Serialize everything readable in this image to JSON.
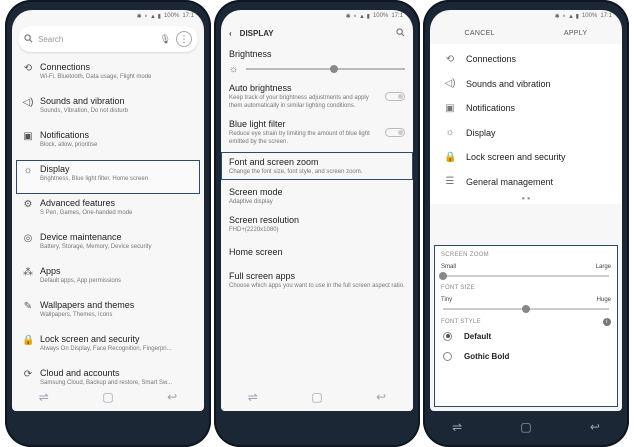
{
  "status": {
    "icons": "✱ ⚬ ▲ ▮",
    "battery": "100%",
    "time": "17:1"
  },
  "navbar": {
    "recent_icon": "recent-apps-icon",
    "home_icon": "home-icon",
    "back_icon": "back-icon"
  },
  "phone1": {
    "search_placeholder": "Search",
    "items": [
      {
        "icon": "connections-icon",
        "title": "Connections",
        "subtitle": "Wi-Fi, Bluetooth, Data usage, Flight mode"
      },
      {
        "icon": "sound-icon",
        "title": "Sounds and vibration",
        "subtitle": "Sounds, Vibration, Do not disturb"
      },
      {
        "icon": "notifications-icon",
        "title": "Notifications",
        "subtitle": "Block, allow, prioritise"
      },
      {
        "icon": "display-icon",
        "title": "Display",
        "subtitle": "Brightness, Blue light filter, Home screen"
      },
      {
        "icon": "advanced-features-icon",
        "title": "Advanced features",
        "subtitle": "S Pen, Games, One-handed mode"
      },
      {
        "icon": "device-maintenance-icon",
        "title": "Device maintenance",
        "subtitle": "Battery, Storage, Memory, Device security"
      },
      {
        "icon": "apps-icon",
        "title": "Apps",
        "subtitle": "Default apps, App permissions"
      },
      {
        "icon": "wallpaper-icon",
        "title": "Wallpapers and themes",
        "subtitle": "Wallpapers, Themes, Icons"
      },
      {
        "icon": "lock-icon",
        "title": "Lock screen and security",
        "subtitle": "Always On Display, Face Recognition, Fingerpri..."
      },
      {
        "icon": "accounts-icon",
        "title": "Cloud and accounts",
        "subtitle": "Samsung Cloud, Backup and restore, Smart Sw..."
      }
    ]
  },
  "phone2": {
    "title": "DISPLAY",
    "brightness_label": "Brightness",
    "brightness_level": 0.55,
    "auto_brightness": {
      "title": "Auto brightness",
      "subtitle": "Keep track of your brightness adjustments and apply them automatically in similar lighting conditions."
    },
    "blue_light": {
      "title": "Blue light filter",
      "subtitle": "Reduce eye strain by limiting the amount of blue light emitted by the screen."
    },
    "font_zoom": {
      "title": "Font and screen zoom",
      "subtitle": "Change the font size, font style, and screen zoom."
    },
    "screen_mode": {
      "title": "Screen mode",
      "subtitle": "Adaptive display"
    },
    "resolution": {
      "title": "Screen resolution",
      "subtitle": "FHD+(2220x1080)"
    },
    "home_screen": {
      "title": "Home screen"
    },
    "full_screen": {
      "title": "Full screen apps",
      "subtitle": "Choose which apps you want to use in the full screen aspect ratio."
    }
  },
  "phone3": {
    "cancel": "CANCEL",
    "apply": "APPLY",
    "preview_items": [
      {
        "icon": "connections-icon",
        "label": "Connections"
      },
      {
        "icon": "sound-icon",
        "label": "Sounds and vibration"
      },
      {
        "icon": "notifications-icon",
        "label": "Notifications"
      },
      {
        "icon": "display-icon",
        "label": "Display"
      },
      {
        "icon": "lock-icon",
        "label": "Lock screen and security"
      },
      {
        "icon": "general-management-icon",
        "label": "General management"
      }
    ],
    "screen_zoom": {
      "heading": "SCREEN ZOOM",
      "min": "Small",
      "max": "Large",
      "level": 0.0
    },
    "font_size": {
      "heading": "FONT SIZE",
      "min": "Tiny",
      "max": "Huge",
      "level": 0.5
    },
    "font_style": {
      "heading": "FONT STYLE",
      "options": [
        "Default",
        "Gothic Bold"
      ],
      "selected": "Default"
    }
  }
}
